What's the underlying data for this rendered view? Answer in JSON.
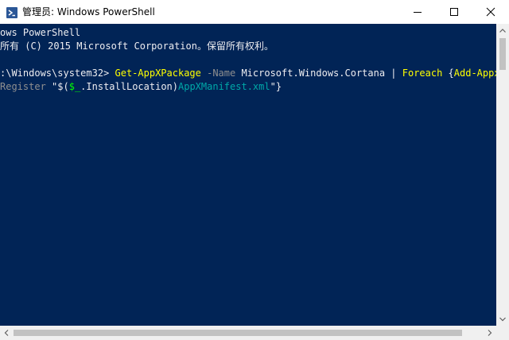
{
  "window": {
    "title": "管理员: Windows PowerShell",
    "icon": "powershell-icon",
    "controls": [
      "minimize-icon",
      "maximize-icon",
      "close-icon"
    ]
  },
  "console": {
    "background": "#012456",
    "lines": [
      [
        {
          "text": "ows PowerShell",
          "role": "default"
        }
      ],
      [
        {
          "text": "所有 (C) 2015 Microsoft Corporation。保留所有权利。",
          "role": "default"
        }
      ],
      [
        {
          "text": "",
          "role": "default"
        }
      ],
      [
        {
          "text": ":\\Windows\\system32> ",
          "role": "default"
        },
        {
          "text": "Get-AppXPackage",
          "role": "cmdlet"
        },
        {
          "text": " -Name ",
          "role": "param"
        },
        {
          "text": "Microsoft.Windows.Cortana | ",
          "role": "default"
        },
        {
          "text": "Foreach",
          "role": "cmdlet"
        },
        {
          "text": " {",
          "role": "default"
        },
        {
          "text": "Add-AppxPackage",
          "role": "cmdlet"
        }
      ],
      [
        {
          "text": "Register ",
          "role": "dim"
        },
        {
          "text": "\"$(",
          "role": "default"
        },
        {
          "text": "$_",
          "role": "var"
        },
        {
          "text": ".InstallLocation)",
          "role": "default"
        },
        {
          "text": "AppXManifest.xml",
          "role": "path"
        },
        {
          "text": "\"}",
          "role": "default"
        }
      ]
    ]
  },
  "colors": {
    "text": "#eeedf0",
    "cmdlet": "#ffff00",
    "parameter": "#8f8f8f",
    "variable": "#00ff00",
    "path": "#00a8a8"
  }
}
